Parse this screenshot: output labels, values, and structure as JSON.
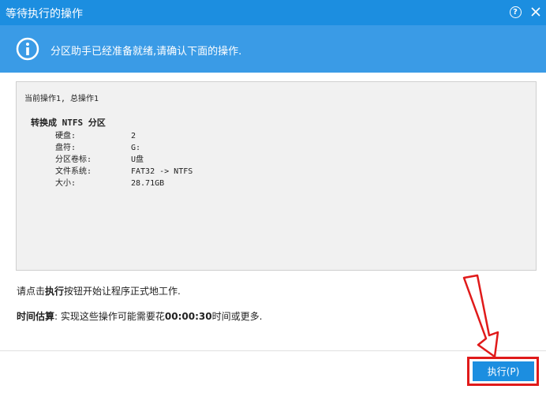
{
  "window": {
    "title": "等待执行的操作",
    "help_icon": "question-icon",
    "close_icon": "close-icon"
  },
  "banner": {
    "icon": "info-icon",
    "message": "分区助手已经准备就绪,请确认下面的操作."
  },
  "details": {
    "current_op": "当前操作1, 总操作1",
    "op_title": "转换成 NTFS 分区",
    "properties": [
      {
        "key": "硬盘:",
        "value": "2"
      },
      {
        "key": "盘符:",
        "value": "G:"
      },
      {
        "key": "分区卷标:",
        "value": "U盘"
      },
      {
        "key": "文件系统:",
        "value": "FAT32 -> NTFS"
      },
      {
        "key": "大小:",
        "value": "28.71GB"
      }
    ]
  },
  "instruction": {
    "prefix": "请点击",
    "button_ref": "执行",
    "suffix": "按钮开始让程序正式地工作."
  },
  "estimate": {
    "label": "时间估算",
    "text_before": ": 实现这些操作可能需要花",
    "time": "00:00:30",
    "text_after": "时间或更多."
  },
  "footer": {
    "execute_label": "执行(P)"
  },
  "colors": {
    "titlebar": "#1c8ee0",
    "banner": "#3a9be6",
    "highlight": "#e01a1a"
  }
}
